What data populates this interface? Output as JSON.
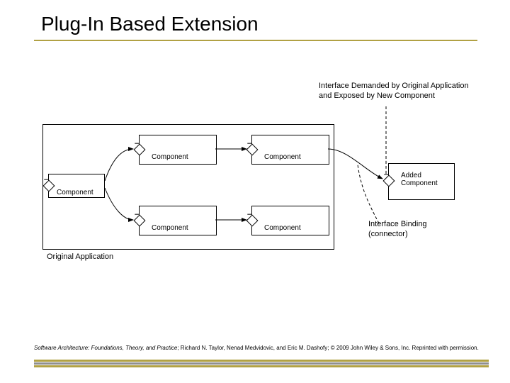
{
  "title": "Plug-In Based Extension",
  "diagram": {
    "original_application_label": "Original Application",
    "components": {
      "c1": "Component",
      "c2": "Component",
      "c3": "Component",
      "c4": "Component",
      "c5": "Component"
    },
    "added_component_label": "Added\nComponent",
    "annotation_top": "Interface Demanded by Original Application\nand Exposed by New Component",
    "annotation_bottom": "Interface Binding\n(connector)"
  },
  "attribution": {
    "italic": "Software Architecture: Foundations, Theory, and Practice",
    "rest": "; Richard N. Taylor, Nenad Medvidovic, and Eric M. Dashofy; © 2009 John Wiley & Sons, Inc. Reprinted with permission."
  }
}
